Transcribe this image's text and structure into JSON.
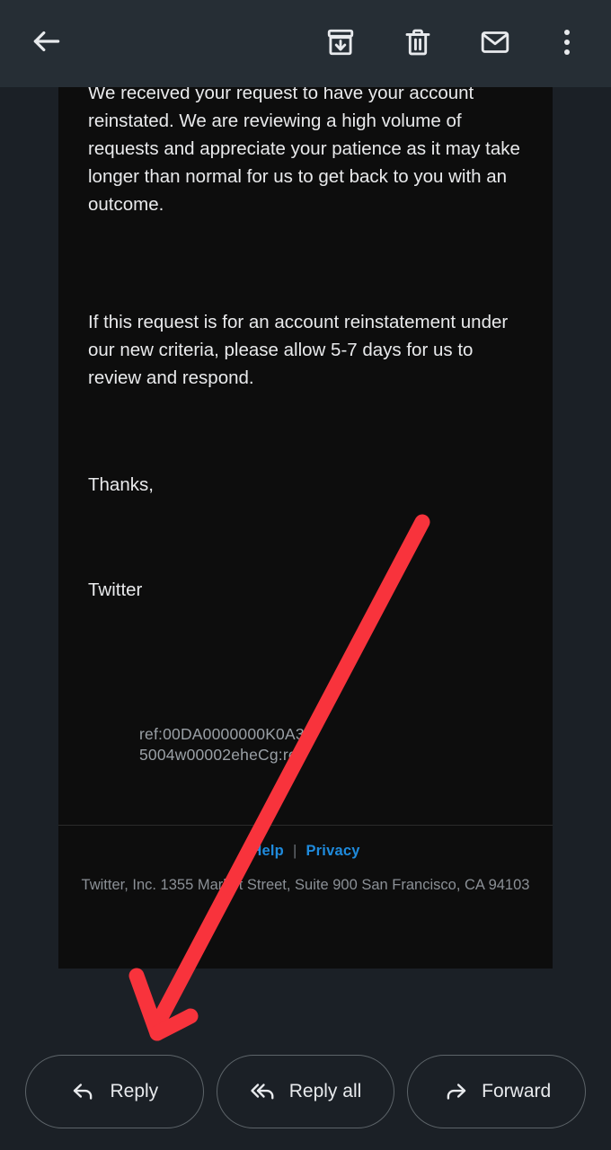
{
  "toolbar": {
    "back_label": "Back",
    "icons": [
      {
        "name": "archive-icon",
        "label": "Archive"
      },
      {
        "name": "trash-icon",
        "label": "Delete"
      },
      {
        "name": "mail-icon",
        "label": "Mark as unread"
      },
      {
        "name": "more-options-icon",
        "label": "More options"
      }
    ],
    "background_color": "#262e35"
  },
  "email": {
    "background_color": "#0d0d0d",
    "paragraph_1": "We received your request to have your account reinstated. We are reviewing a high volume of requests and appreciate your patience as it may take longer than normal for us to get back to you with an outcome.",
    "paragraph_2": "If this request is for an account reinstatement under our new criteria, please allow 5-7 days for us to review and respond.",
    "signoff": "Thanks,",
    "sender": "Twitter",
    "ref_line_1": "ref:00DA0000000K0A3.",
    "ref_line_2": "5004w00002eheCg:ref",
    "footer": {
      "help_label": "Help",
      "separator": "|",
      "privacy_label": "Privacy",
      "link_color": "#1f8bdd",
      "address": "Twitter, Inc. 1355 Market Street, Suite 900 San Francisco, CA 94103"
    }
  },
  "actions": [
    {
      "name": "reply-button",
      "label": "Reply",
      "icon": "reply-arrow-icon"
    },
    {
      "name": "reply-all-button",
      "label": "Reply all",
      "icon": "reply-all-arrow-icon"
    },
    {
      "name": "forward-button",
      "label": "Forward",
      "icon": "forward-arrow-icon"
    }
  ],
  "annotation": {
    "type": "arrow",
    "color": "#f8333c",
    "points_to": "reply-button"
  }
}
